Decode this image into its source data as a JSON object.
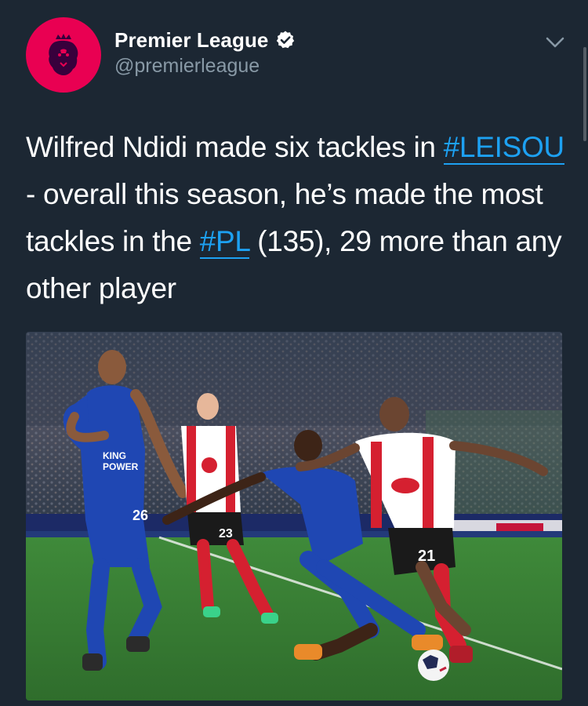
{
  "tweet": {
    "author": {
      "name": "Premier League",
      "handle": "@premierleague",
      "verified": true,
      "avatar_icon": "premier-league-lion-icon",
      "avatar_color": "#e90052"
    },
    "text": {
      "part1": "Wilfred Ndidi made six tackles in",
      "hashtag1": "#LEISOU",
      "part2": " - overall this season, he’s made the most tackles in the ",
      "hashtag2": "#PL",
      "part3": " (135), 29 more than any other player"
    },
    "more_icon": "chevron-down-icon",
    "media": {
      "kit_numbers": [
        "26",
        "23",
        "21"
      ],
      "shirt_text": [
        "KING",
        "POWER"
      ]
    }
  },
  "colors": {
    "background": "#1c2733",
    "link": "#1da1f2",
    "secondary_text": "#8899a6"
  }
}
